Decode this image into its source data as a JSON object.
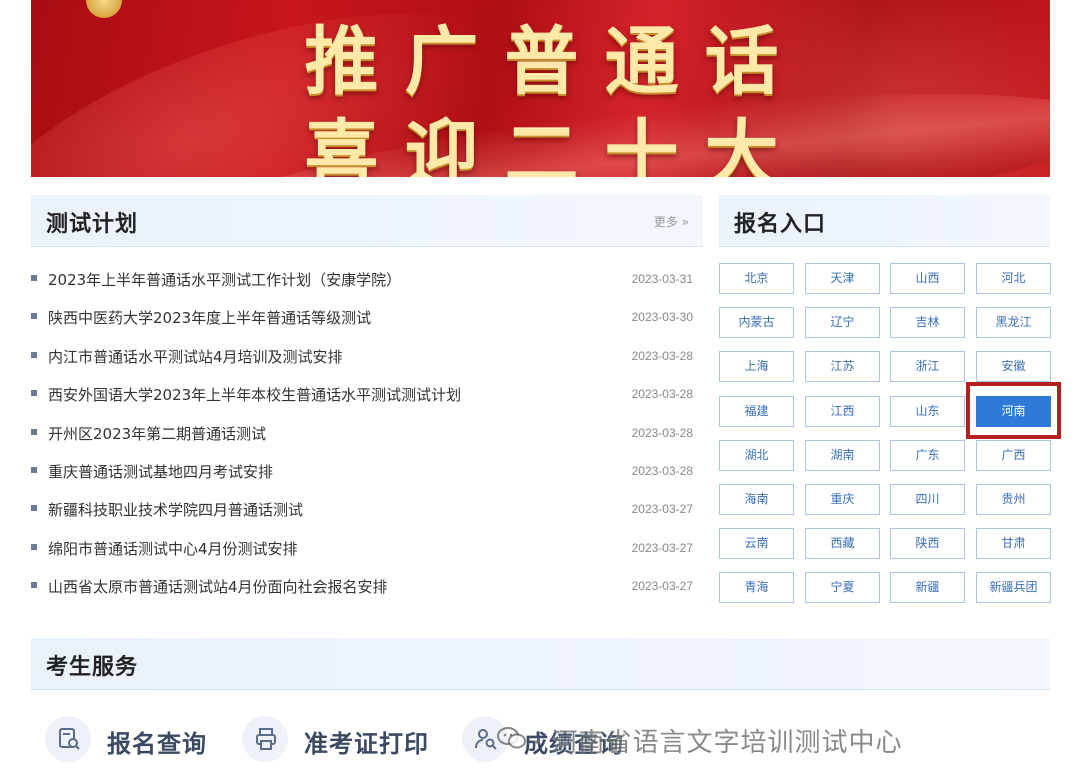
{
  "banner": {
    "line1": "推广普通话",
    "line2": "喜迎二十大"
  },
  "test_plan": {
    "title": "测试计划",
    "more": "更多 »",
    "items": [
      {
        "title": "2023年上半年普通话水平测试工作计划（安康学院）",
        "date": "2023-03-31"
      },
      {
        "title": "陕西中医药大学2023年度上半年普通话等级测试",
        "date": "2023-03-30"
      },
      {
        "title": "内江市普通话水平测试站4月培训及测试安排",
        "date": "2023-03-28"
      },
      {
        "title": "西安外国语大学2023年上半年本校生普通话水平测试测试计划",
        "date": "2023-03-28"
      },
      {
        "title": "开州区2023年第二期普通话测试",
        "date": "2023-03-28"
      },
      {
        "title": "重庆普通话测试基地四月考试安排",
        "date": "2023-03-28"
      },
      {
        "title": "新疆科技职业技术学院四月普通话测试",
        "date": "2023-03-27"
      },
      {
        "title": "绵阳市普通话测试中心4月份测试安排",
        "date": "2023-03-27"
      },
      {
        "title": "山西省太原市普通话测试站4月份面向社会报名安排",
        "date": "2023-03-27"
      }
    ]
  },
  "registration": {
    "title": "报名入口",
    "provinces": [
      "北京",
      "天津",
      "山西",
      "河北",
      "内蒙古",
      "辽宁",
      "吉林",
      "黑龙江",
      "上海",
      "江苏",
      "浙江",
      "安徽",
      "福建",
      "江西",
      "山东",
      "河南",
      "湖北",
      "湖南",
      "广东",
      "广西",
      "海南",
      "重庆",
      "四川",
      "贵州",
      "云南",
      "西藏",
      "陕西",
      "甘肃",
      "青海",
      "宁夏",
      "新疆",
      "新疆兵团"
    ],
    "selected": "河南"
  },
  "services": {
    "title": "考生服务",
    "items": [
      {
        "label": "报名查询",
        "icon": "search-doc-icon"
      },
      {
        "label": "准考证打印",
        "icon": "printer-icon"
      },
      {
        "label": "成绩查询",
        "icon": "user-search-icon"
      }
    ]
  },
  "watermark": {
    "text": "· 河南省语言文字培训测试中心"
  },
  "colors": {
    "accent": "#2f7ad8",
    "banner_red": "#c8161c",
    "highlight": "#b5201f"
  }
}
